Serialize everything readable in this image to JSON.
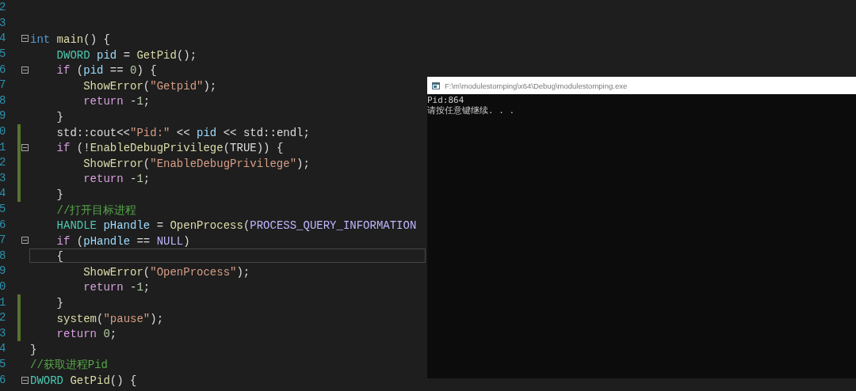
{
  "editor": {
    "lines": [
      {
        "number": "2",
        "fold": false,
        "changed": false,
        "current": false
      },
      {
        "number": "3",
        "fold": false,
        "changed": false,
        "current": false
      },
      {
        "number": "4",
        "fold": true,
        "changed": false,
        "current": false,
        "tokens": [
          {
            "text": "int",
            "kind": "keyword"
          },
          {
            "text": " main",
            "kind": "func"
          },
          {
            "text": "() {",
            "kind": "plain"
          }
        ]
      },
      {
        "number": "5",
        "fold": false,
        "changed": false,
        "current": false,
        "tokens": [
          {
            "text": "    DWORD",
            "kind": "type"
          },
          {
            "text": " pid",
            "kind": "var"
          },
          {
            "text": " = ",
            "kind": "plain"
          },
          {
            "text": "GetPid",
            "kind": "func"
          },
          {
            "text": "();",
            "kind": "plain"
          }
        ]
      },
      {
        "number": "6",
        "fold": true,
        "changed": false,
        "current": false,
        "tokens": [
          {
            "text": "    if",
            "kind": "control"
          },
          {
            "text": " (",
            "kind": "plain"
          },
          {
            "text": "pid",
            "kind": "var"
          },
          {
            "text": " == ",
            "kind": "plain"
          },
          {
            "text": "0",
            "kind": "number"
          },
          {
            "text": ") {",
            "kind": "plain"
          }
        ]
      },
      {
        "number": "7",
        "fold": false,
        "changed": false,
        "current": false,
        "tokens": [
          {
            "text": "        ShowError",
            "kind": "func"
          },
          {
            "text": "(",
            "kind": "plain"
          },
          {
            "text": "\"Getpid\"",
            "kind": "string"
          },
          {
            "text": ");",
            "kind": "plain"
          }
        ]
      },
      {
        "number": "8",
        "fold": false,
        "changed": false,
        "current": false,
        "tokens": [
          {
            "text": "        return",
            "kind": "control"
          },
          {
            "text": " -",
            "kind": "plain"
          },
          {
            "text": "1",
            "kind": "number"
          },
          {
            "text": ";",
            "kind": "plain"
          }
        ]
      },
      {
        "number": "9",
        "fold": false,
        "changed": false,
        "current": false,
        "tokens": [
          {
            "text": "    }",
            "kind": "plain"
          }
        ]
      },
      {
        "number": "0",
        "fold": false,
        "changed": true,
        "current": false,
        "tokens": [
          {
            "text": "    std::cout<<",
            "kind": "plain"
          },
          {
            "text": "\"Pid:\"",
            "kind": "string"
          },
          {
            "text": " << ",
            "kind": "plain"
          },
          {
            "text": "pid",
            "kind": "var"
          },
          {
            "text": " << std::endl;",
            "kind": "plain"
          }
        ]
      },
      {
        "number": "1",
        "fold": true,
        "changed": true,
        "current": false,
        "tokens": [
          {
            "text": "    if",
            "kind": "control"
          },
          {
            "text": " (!",
            "kind": "plain"
          },
          {
            "text": "EnableDebugPrivilege",
            "kind": "func"
          },
          {
            "text": "(TRUE)) {",
            "kind": "plain"
          }
        ]
      },
      {
        "number": "2",
        "fold": false,
        "changed": true,
        "current": false,
        "tokens": [
          {
            "text": "        ShowError",
            "kind": "func"
          },
          {
            "text": "(",
            "kind": "plain"
          },
          {
            "text": "\"EnableDebugPrivilege\"",
            "kind": "string"
          },
          {
            "text": ");",
            "kind": "plain"
          }
        ]
      },
      {
        "number": "3",
        "fold": false,
        "changed": true,
        "current": false,
        "tokens": [
          {
            "text": "        return",
            "kind": "control"
          },
          {
            "text": " -",
            "kind": "plain"
          },
          {
            "text": "1",
            "kind": "number"
          },
          {
            "text": ";",
            "kind": "plain"
          }
        ]
      },
      {
        "number": "4",
        "fold": false,
        "changed": true,
        "current": false,
        "tokens": [
          {
            "text": "    }",
            "kind": "plain"
          }
        ]
      },
      {
        "number": "5",
        "fold": false,
        "changed": false,
        "current": false,
        "tokens": [
          {
            "text": "    //打开目标进程",
            "kind": "comment"
          }
        ]
      },
      {
        "number": "6",
        "fold": false,
        "changed": false,
        "current": false,
        "tokens": [
          {
            "text": "    HANDLE",
            "kind": "type"
          },
          {
            "text": " pHandle",
            "kind": "var"
          },
          {
            "text": " = ",
            "kind": "plain"
          },
          {
            "text": "OpenProcess",
            "kind": "func"
          },
          {
            "text": "(",
            "kind": "plain"
          },
          {
            "text": "PROCESS_QUERY_INFORMATION",
            "kind": "macro"
          }
        ]
      },
      {
        "number": "7",
        "fold": true,
        "changed": false,
        "current": false,
        "tokens": [
          {
            "text": "    if",
            "kind": "control"
          },
          {
            "text": " (",
            "kind": "plain"
          },
          {
            "text": "pHandle",
            "kind": "var"
          },
          {
            "text": " == ",
            "kind": "plain"
          },
          {
            "text": "NULL",
            "kind": "macro"
          },
          {
            "text": ")",
            "kind": "plain"
          }
        ]
      },
      {
        "number": "8",
        "fold": false,
        "changed": false,
        "current": true,
        "tokens": [
          {
            "text": "    {",
            "kind": "plain"
          }
        ]
      },
      {
        "number": "9",
        "fold": false,
        "changed": false,
        "current": false,
        "tokens": [
          {
            "text": "        ShowError",
            "kind": "func"
          },
          {
            "text": "(",
            "kind": "plain"
          },
          {
            "text": "\"OpenProcess\"",
            "kind": "string"
          },
          {
            "text": ");",
            "kind": "plain"
          }
        ]
      },
      {
        "number": "0",
        "fold": false,
        "changed": false,
        "current": false,
        "tokens": [
          {
            "text": "        return",
            "kind": "control"
          },
          {
            "text": " -",
            "kind": "plain"
          },
          {
            "text": "1",
            "kind": "number"
          },
          {
            "text": ";",
            "kind": "plain"
          }
        ]
      },
      {
        "number": "1",
        "fold": false,
        "changed": true,
        "current": false,
        "tokens": [
          {
            "text": "    }",
            "kind": "plain"
          }
        ]
      },
      {
        "number": "2",
        "fold": false,
        "changed": true,
        "current": false,
        "tokens": [
          {
            "text": "    system",
            "kind": "func"
          },
          {
            "text": "(",
            "kind": "plain"
          },
          {
            "text": "\"pause\"",
            "kind": "string"
          },
          {
            "text": ");",
            "kind": "plain"
          }
        ]
      },
      {
        "number": "3",
        "fold": false,
        "changed": true,
        "current": false,
        "tokens": [
          {
            "text": "    return",
            "kind": "control"
          },
          {
            "text": " 0",
            "kind": "number"
          },
          {
            "text": ";",
            "kind": "plain"
          }
        ]
      },
      {
        "number": "4",
        "fold": false,
        "changed": false,
        "current": false,
        "tokens": [
          {
            "text": "}",
            "kind": "plain"
          }
        ]
      },
      {
        "number": "5",
        "fold": false,
        "changed": false,
        "current": false,
        "tokens": [
          {
            "text": "//获取进程Pid",
            "kind": "comment"
          }
        ]
      },
      {
        "number": "6",
        "fold": true,
        "changed": false,
        "current": false,
        "tokens": [
          {
            "text": "DWORD",
            "kind": "type"
          },
          {
            "text": " GetPid",
            "kind": "func"
          },
          {
            "text": "() {",
            "kind": "plain"
          }
        ]
      }
    ]
  },
  "console": {
    "title": "F:\\m\\modulestomping\\x64\\Debug\\modulestomping.exe",
    "lines": [
      "Pid:864",
      "请按任意键继续. . ."
    ]
  }
}
